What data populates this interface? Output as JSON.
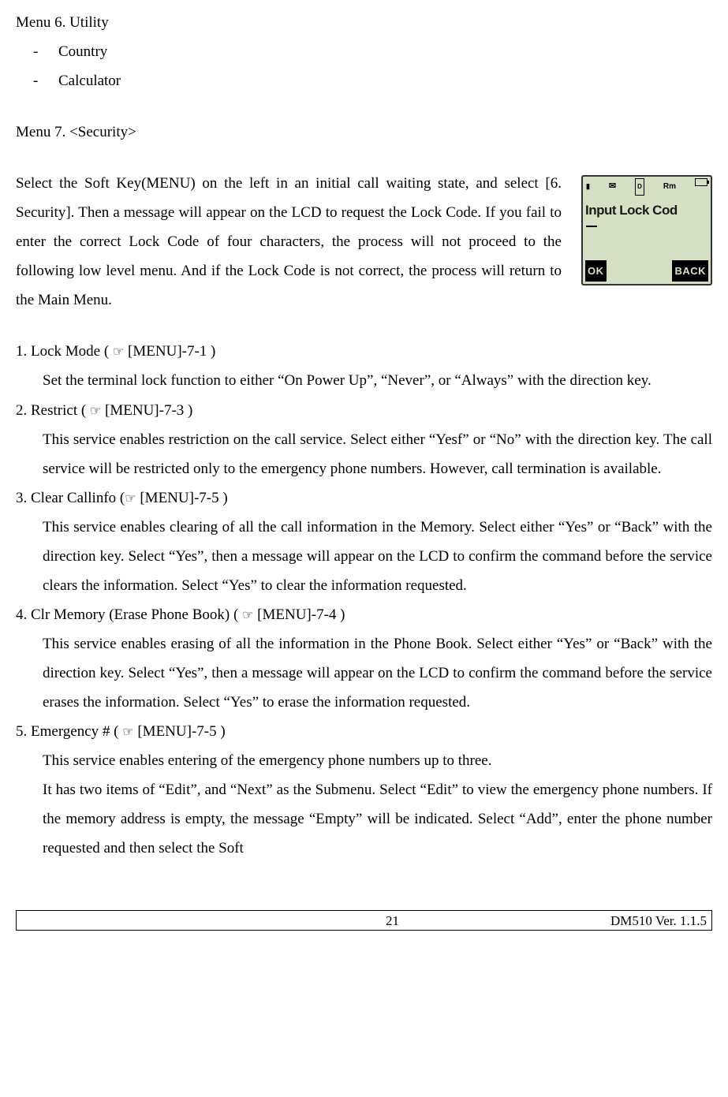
{
  "menu6": {
    "title": "Menu 6. Utility",
    "items": [
      "Country",
      "Calculator"
    ]
  },
  "menu7": {
    "title": "Menu 7. <Security>",
    "intro": "Select the Soft Key(MENU) on the left in an initial call waiting state, and select [6. Security]. Then a message will appear on the LCD to request the Lock Code. If you fail to enter the correct Lock Code of four characters, the process will not proceed to the following low level menu. And if the Lock Code is not correct, the process will return to the Main Menu."
  },
  "lcd": {
    "title": "Input Lock Cod",
    "ok": "OK",
    "back": "BACK",
    "status_rm": "Rm",
    "status_d": "D"
  },
  "items": [
    {
      "num": "1. Lock Mode ( ",
      "ref": " [MENU]-7-1 )",
      "body": "Set the terminal lock function to either “On Power Up”,   “Never”, or “Always” with the direction key."
    },
    {
      "num": "2. Restrict ( ",
      "ref": " [MENU]-7-3 )",
      "body": "This service enables restriction on the call service. Select either “Yesf” or “No” with the direction key. The call service will be restricted only to the emergency phone numbers. However, call termination is available."
    },
    {
      "num": "3. Clear Callinfo (",
      "ref": " [MENU]-7-5 )",
      "body": "This service enables clearing of all the call information in the Memory. Select either “Yes” or “Back” with the direction key. Select “Yes”, then a message will appear on the LCD to confirm the command before the service clears the information. Select “Yes” to clear the information requested."
    },
    {
      "num": "4. Clr Memory (Erase Phone Book) ( ",
      "ref": " [MENU]-7-4 )",
      "body": "This service enables erasing of all the information in the Phone Book. Select either “Yes” or “Back” with the direction key. Select “Yes”, then a message will appear on the LCD to confirm the command before the service erases the information. Select “Yes” to erase the information requested."
    },
    {
      "num": "5. Emergency # ( ",
      "ref": " [MENU]-7-5 )",
      "body1": "This service enables entering of the emergency phone numbers up to three.",
      "body2": "It has two  items of “Edit”, and “Next” as the Submenu. Select “Edit” to view the emergency phone numbers. If the memory address is empty, the message “Empty” will be indicated. Select “Add”, enter the phone number requested and then select the Soft"
    }
  ],
  "footer": {
    "page": "21",
    "version": "DM510    Ver. 1.1.5"
  }
}
